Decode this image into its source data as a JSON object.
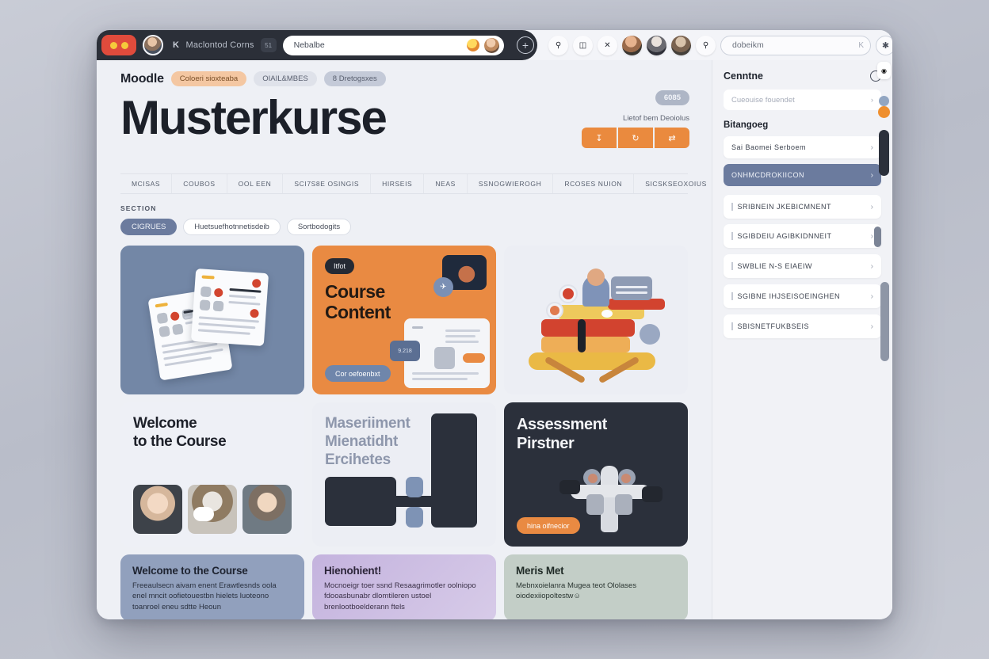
{
  "browser": {
    "tab_glyph": "K",
    "tab_title": "Maclontod Corns",
    "tab_chip": "51",
    "omnibox_value": "Nebalbe",
    "new_tab_icon": "plus-circle-icon",
    "toolbar_icons": [
      "cart-icon",
      "bag-icon",
      "close-icon",
      "profile-icon",
      "profile-icon",
      "profile-icon",
      "cart-icon"
    ],
    "search_value": "dobeikm",
    "search_shortcut": "K",
    "star_icon": "star-icon",
    "extension_icon": "extension-icon"
  },
  "header": {
    "brand": "Moodle",
    "badges": [
      {
        "label": "Coloeri sioxteaba",
        "style": "orange"
      },
      {
        "label": "OIAIL&MBES",
        "style": "grey"
      },
      {
        "label": "8 Dretogsxes",
        "style": "blue"
      }
    ],
    "title": "Musterkurse",
    "count_badge": "6085",
    "action_label": "Lietof bem Deoiolus",
    "actions": [
      {
        "icon": "download-icon",
        "glyph": "↧"
      },
      {
        "icon": "refresh-icon",
        "glyph": "↻"
      },
      {
        "icon": "swap-icon",
        "glyph": "⇄"
      }
    ],
    "nav_tabs": [
      "MCISAS",
      "COUBOS",
      "OOL EEN",
      "SCI7S8E OSINGIS",
      "HIRSEIS",
      "NEAS",
      "SSNOGWIEROGH",
      "RCOSES NUION",
      "SICSKSEOXOIUS"
    ]
  },
  "section": {
    "label": "SECTION",
    "chips": [
      {
        "label": "CIGRUES",
        "active": true
      },
      {
        "label": "Huetsuefhotnnetisdeib",
        "active": false
      },
      {
        "label": "Sortbodogits",
        "active": false
      }
    ]
  },
  "cards": {
    "course_content": {
      "tag": "Itfot",
      "title_line1": "Course",
      "title_line2": "Content",
      "cta": "Cor oefoenbxt",
      "mini_label": "9.218"
    },
    "welcome_people": {
      "title_line1": "Welcome",
      "title_line2": "to the Course"
    },
    "management": {
      "title_line1": "Maseriiment",
      "title_line2": "Mienatidht",
      "title_line3": "Ercihetes"
    },
    "assessment": {
      "title_line1": "Assessment",
      "title_line2": "Pirstner",
      "cta": "hina oifnecior"
    },
    "strip": [
      {
        "title": "Welcome to the Course",
        "body": "Freeaulsecn aivam enent Erawtlesnds oola enel mncit oofietouestbn hielets luoteono toanroel eneu sdtte Heoun"
      },
      {
        "title": "Hienohient!",
        "body": "Mocnoeigr toer ssnd Resaagrimotler oolniopo fdooasbunabr dlomtileren ustoel brenlootboelderann ftels"
      },
      {
        "title": "Meris Met",
        "body": "Mebnxoielanra Mugea teot Ololases oiodexiiopoltestw☺"
      }
    ]
  },
  "sidebar": {
    "title": "Cenntne",
    "ring_icon": "circle-icon",
    "search_placeholder": "Cueouise fouendet",
    "section_label": "Bitangoeg",
    "items": [
      {
        "label": "Sai Baomei Serboem",
        "selected": false,
        "has_bar": false
      },
      {
        "label": "ONHMCDROKIICON",
        "selected": true,
        "has_bar": false
      },
      {
        "label": "SRIBNEIN JKEBICMNENT",
        "selected": false,
        "has_bar": true
      },
      {
        "label": "SGIBDEIU AGIBKIDNNEIT",
        "selected": false,
        "has_bar": true
      },
      {
        "label": "SWBLIE N-S EIAEIW",
        "selected": false,
        "has_bar": true
      },
      {
        "label": "SGIBNE IHJSEISOEINGHEN",
        "selected": false,
        "has_bar": true
      },
      {
        "label": "SBISNETFUKBSEIS",
        "selected": false,
        "has_bar": true
      }
    ],
    "chevron": "›"
  },
  "colors": {
    "accent_orange": "#e98a42",
    "accent_blue": "#6b7b9e",
    "dark": "#2b303b",
    "page_bg": "#eef0f5"
  }
}
